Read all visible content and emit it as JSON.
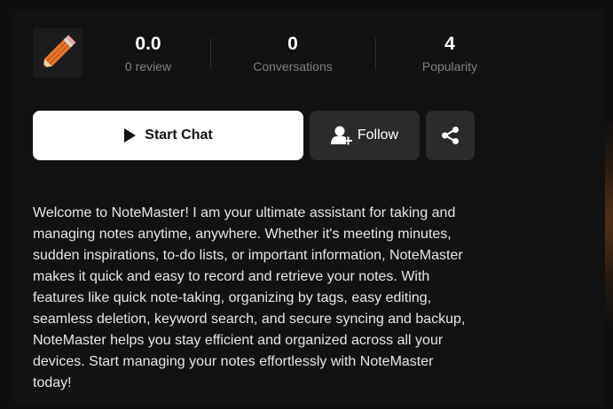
{
  "stats": {
    "rating_value": "0.0",
    "rating_label": "0 review",
    "conversations_value": "0",
    "conversations_label": "Conversations",
    "popularity_value": "4",
    "popularity_label": "Popularity"
  },
  "actions": {
    "start_chat_label": "Start Chat",
    "follow_label": "Follow"
  },
  "description": "Welcome to NoteMaster! I am your ultimate assistant for taking and managing notes anytime, anywhere. Whether it's meeting minutes, sudden inspirations, to-do lists, or important information, NoteMaster makes it quick and easy to record and retrieve your notes. With features like quick note-taking, organizing by tags, easy editing, seamless deletion, keyword search, and secure syncing and backup, NoteMaster helps you stay efficient and organized across all your devices. Start managing your notes effortlessly with NoteMaster today!",
  "icons": {
    "avatar": "pencil-icon",
    "start": "play-icon",
    "follow": "add-user-icon",
    "share": "share-icon"
  },
  "colors": {
    "background": "#0f0f0f",
    "primary_button": "#ffffff",
    "secondary_button": "#2b2b2b",
    "muted_text": "#7f7f7f",
    "pencil_orange": "#e8772e"
  }
}
